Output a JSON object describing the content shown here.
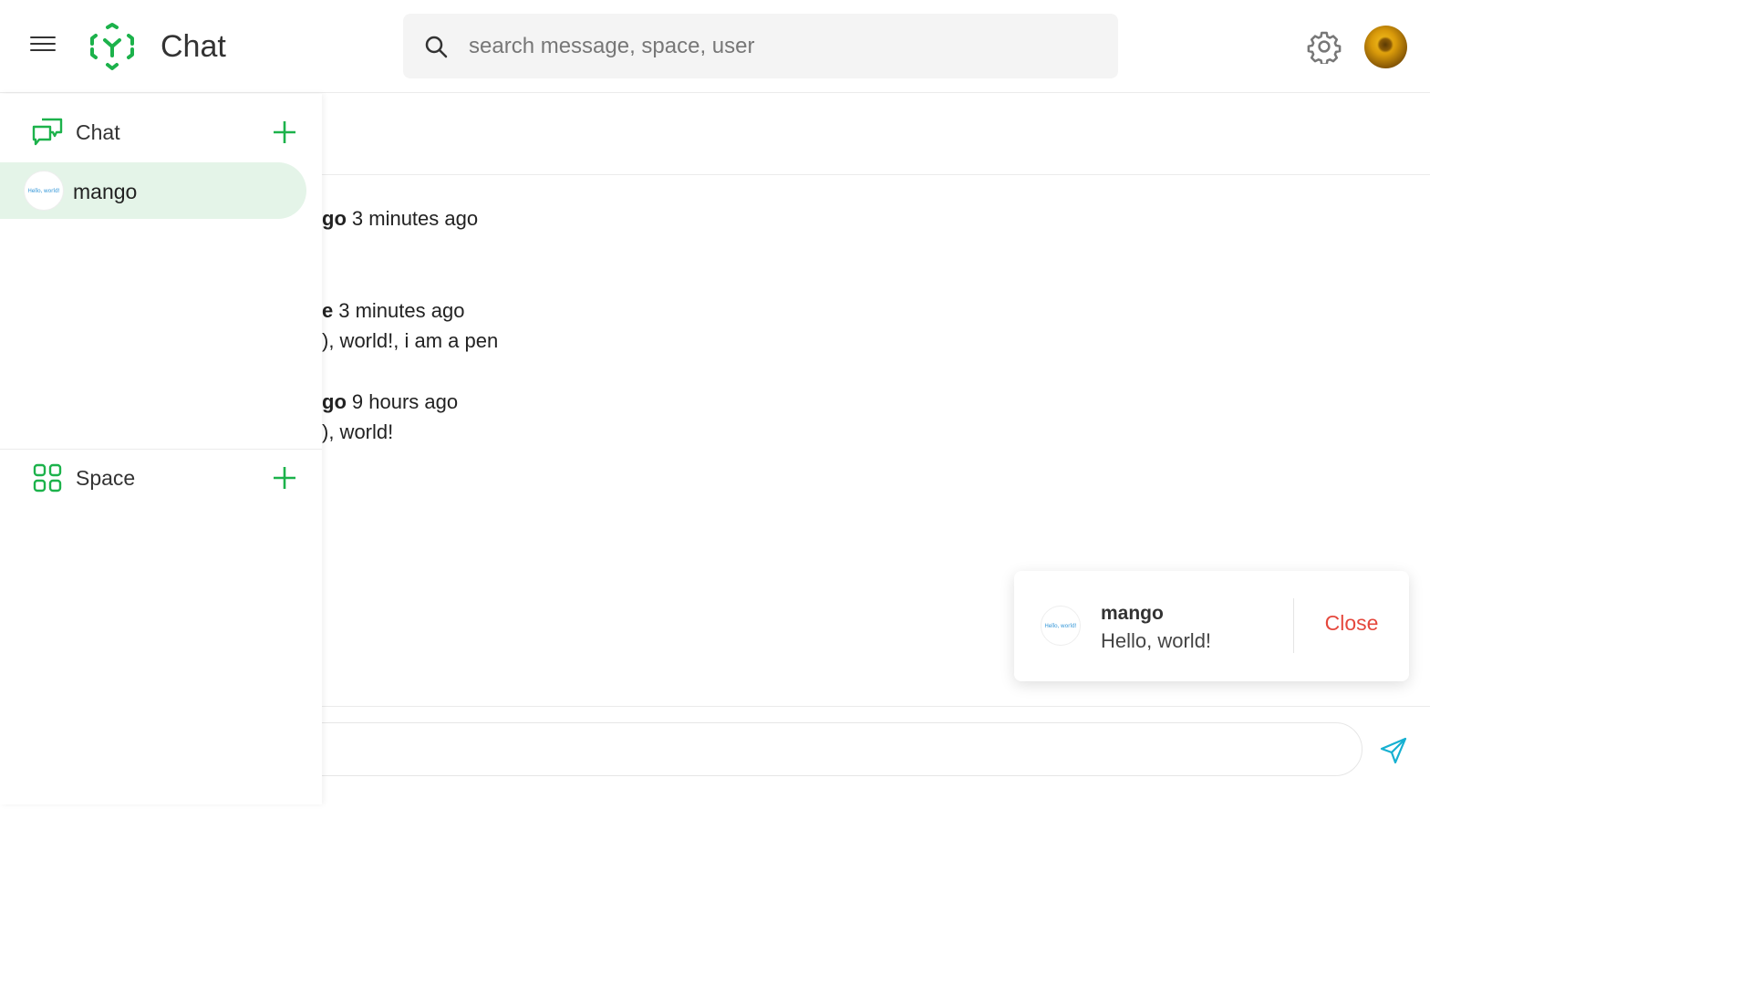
{
  "app": {
    "title": "Chat",
    "accent_color": "#1cb24b"
  },
  "search": {
    "placeholder": "search message, space, user"
  },
  "sidebar": {
    "chat_section": {
      "label": "Chat"
    },
    "chats": [
      {
        "name": "mango",
        "avatar_text": "Hello, world!"
      }
    ],
    "space_section": {
      "label": "Space"
    }
  },
  "messages": [
    {
      "sender": "go",
      "time": "3 minutes ago",
      "text": ""
    },
    {
      "sender": "e",
      "time": "3 minutes ago",
      "text": "), world!, i am a pen"
    },
    {
      "sender": "go",
      "time": "9 hours ago",
      "text": "), world!"
    }
  ],
  "toast": {
    "name": "mango",
    "message": "Hello, world!",
    "avatar_text": "Hello, world!",
    "close_label": "Close",
    "close_color": "#e5483d"
  }
}
